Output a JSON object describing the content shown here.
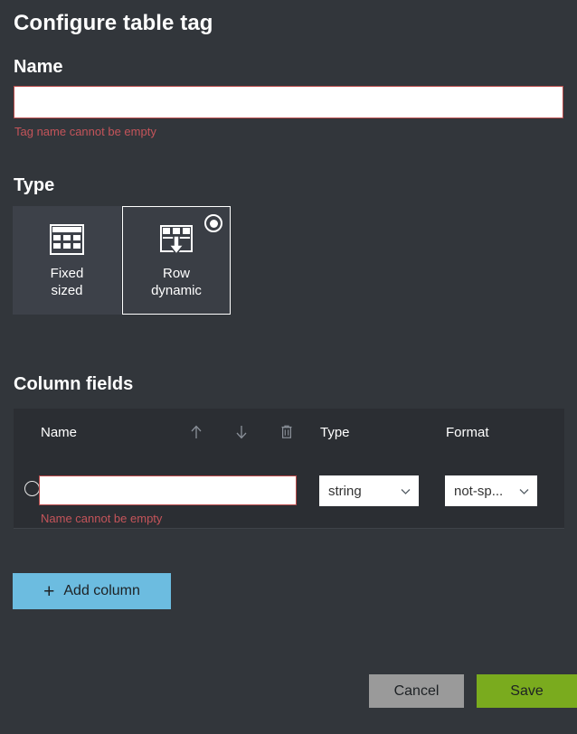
{
  "dialog": {
    "title": "Configure table tag"
  },
  "name_section": {
    "heading": "Name",
    "value": "",
    "placeholder": "",
    "error": "Tag name cannot be empty"
  },
  "type_section": {
    "heading": "Type",
    "options": [
      {
        "label_line1": "Fixed",
        "label_line2": "sized",
        "icon": "table-grid-icon",
        "selected": false
      },
      {
        "label_line1": "Row",
        "label_line2": "dynamic",
        "icon": "table-row-dynamic-icon",
        "selected": true
      }
    ]
  },
  "columns_section": {
    "heading": "Column fields",
    "headers": {
      "name": "Name",
      "move_up_icon": "arrow-up-icon",
      "move_down_icon": "arrow-down-icon",
      "delete_icon": "trash-icon",
      "type": "Type",
      "format": "Format"
    },
    "rows": [
      {
        "selected": false,
        "name_value": "",
        "name_placeholder": "",
        "name_error": "Name cannot be empty",
        "type_value": "string",
        "format_value": "not-sp..."
      }
    ],
    "add_button": {
      "label": "Add column",
      "icon": "plus-icon"
    }
  },
  "footer": {
    "cancel_label": "Cancel",
    "save_label": "Save"
  },
  "colors": {
    "page_background": "#32363b",
    "card_background": "#3d4149",
    "table_background": "#2b2e33",
    "error_text": "#c4545a",
    "input_border_error": "#b94b4b",
    "add_button": "#6cbce0",
    "cancel_button": "#9a9a9a",
    "save_button": "#7aab1e"
  }
}
